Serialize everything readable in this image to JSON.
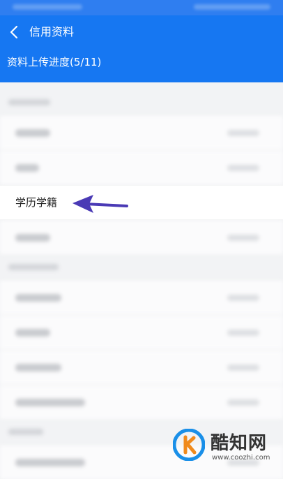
{
  "header": {
    "title": "信用资料",
    "progress_text": "资料上传进度(5/11)"
  },
  "list": {
    "highlighted_item": "学历学籍"
  },
  "watermark": {
    "name": "酷知网",
    "url": "www.coozhi.com"
  },
  "colors": {
    "header_bg": "#1677f2",
    "arrow": "#4a3ab5",
    "page_bg": "#f2f3f5"
  },
  "icons": {
    "back": "chevron-left-icon",
    "annotation": "arrow-left-icon"
  }
}
